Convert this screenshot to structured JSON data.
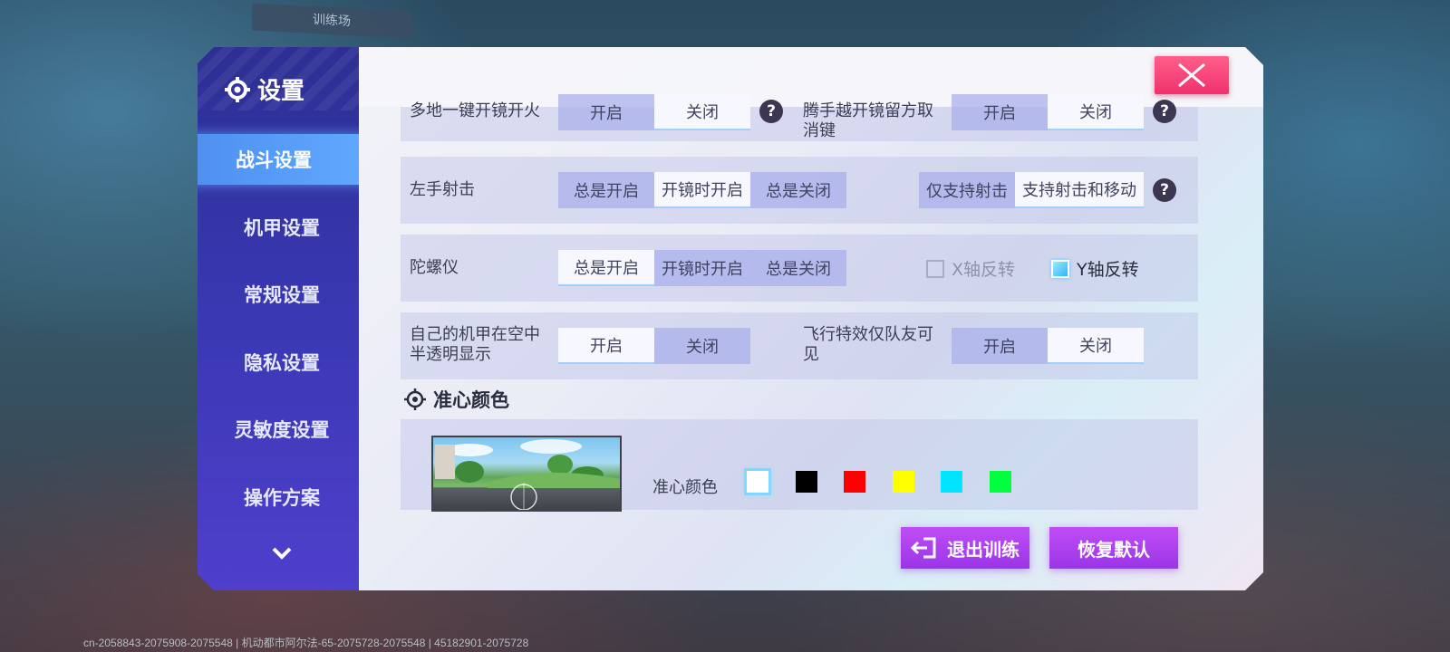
{
  "top_tag": "训练场",
  "debug_info": "cn-2058843-2075908-2075548 | 机动都市阿尔法-65-2075728-2075548 | 45182901-2075728",
  "sidebar": {
    "title": "设置",
    "items": [
      {
        "label": "战斗设置",
        "active": true
      },
      {
        "label": "机甲设置"
      },
      {
        "label": "常规设置"
      },
      {
        "label": "隐私设置"
      },
      {
        "label": "灵敏度设置"
      },
      {
        "label": "操作方案"
      }
    ]
  },
  "rows": {
    "row0": {
      "left_label": "多地一键开镜开火",
      "left_options": [
        "开启",
        "关闭"
      ],
      "left_selected": 1,
      "right_label": "腾手越开镜留方取消键",
      "right_options": [
        "开启",
        "关闭"
      ],
      "right_selected": 1
    },
    "left_hand": {
      "label": "左手射击",
      "options": [
        "总是开启",
        "开镜时开启",
        "总是关闭"
      ],
      "selected": 1,
      "mode_options": [
        "仅支持射击",
        "支持射击和移动"
      ],
      "mode_selected": 1
    },
    "gyro": {
      "label": "陀螺仪",
      "options": [
        "总是开启",
        "开镜时开启",
        "总是关闭"
      ],
      "selected": 0,
      "x_invert": "X轴反转",
      "x_checked": false,
      "y_invert": "Y轴反转",
      "y_checked": true
    },
    "transparency": {
      "left_label": "自己的机甲在空中半透明显示",
      "left_options": [
        "开启",
        "关闭"
      ],
      "left_selected": 0,
      "right_label": "飞行特效仅队友可见",
      "right_options": [
        "开启",
        "关闭"
      ],
      "right_selected": 1
    }
  },
  "crosshair": {
    "section_title": "准心颜色",
    "label": "准心颜色",
    "colors": [
      "#ffffff",
      "#000000",
      "#ff0000",
      "#ffff00",
      "#00e5ff",
      "#00ff3c"
    ],
    "selected": 0
  },
  "buttons": {
    "exit_training": "退出训练",
    "restore_default": "恢复默认"
  },
  "help_symbol": "?"
}
